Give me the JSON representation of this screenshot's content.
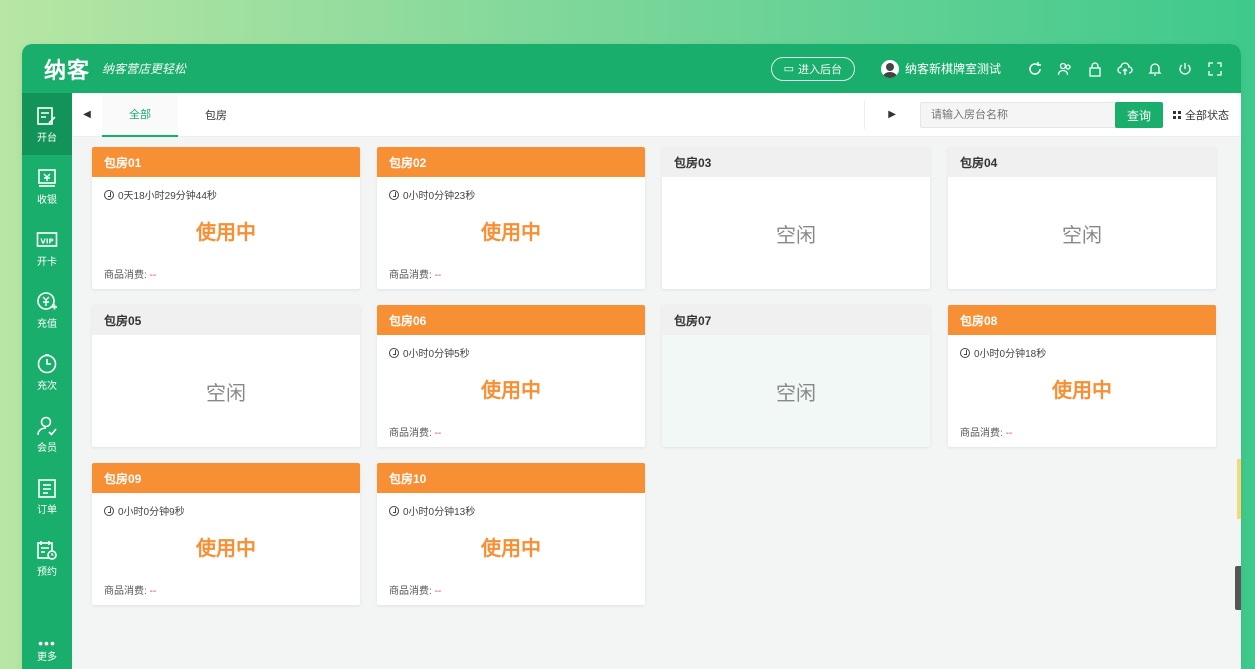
{
  "topbar": {
    "brand": "纳客",
    "slogan": "纳客营店更轻松",
    "backend_label": "进入后台",
    "user_name": "纳客新棋牌室测试"
  },
  "sidebar": {
    "items": [
      {
        "label": "开台",
        "icon": "open-table-icon"
      },
      {
        "label": "收银",
        "icon": "cashier-icon"
      },
      {
        "label": "开卡",
        "icon": "vip-card-icon"
      },
      {
        "label": "充值",
        "icon": "recharge-icon"
      },
      {
        "label": "充次",
        "icon": "recharge-times-icon"
      },
      {
        "label": "会员",
        "icon": "member-icon"
      },
      {
        "label": "订单",
        "icon": "order-icon"
      },
      {
        "label": "预约",
        "icon": "reservation-icon"
      }
    ],
    "more_label": "更多"
  },
  "tabs": [
    {
      "label": "全部",
      "active": true
    },
    {
      "label": "包房",
      "active": false
    }
  ],
  "search": {
    "placeholder": "请输入房台名称",
    "query_label": "查询",
    "all_status_label": "全部状态"
  },
  "rooms": [
    {
      "name": "包房01",
      "status": "使用中",
      "timer": "0天18小时29分钟44秒",
      "consume_label": "商品消费:",
      "consume_value": "--"
    },
    {
      "name": "包房02",
      "status": "使用中",
      "timer": "0小时0分钟23秒",
      "consume_label": "商品消费:",
      "consume_value": "--"
    },
    {
      "name": "包房03",
      "status": "空闲"
    },
    {
      "name": "包房04",
      "status": "空闲"
    },
    {
      "name": "包房05",
      "status": "空闲"
    },
    {
      "name": "包房06",
      "status": "使用中",
      "timer": "0小时0分钟5秒",
      "consume_label": "商品消费:",
      "consume_value": "--"
    },
    {
      "name": "包房07",
      "status": "空闲"
    },
    {
      "name": "包房08",
      "status": "使用中",
      "timer": "0小时0分钟18秒",
      "consume_label": "商品消费:",
      "consume_value": "--"
    },
    {
      "name": "包房09",
      "status": "使用中",
      "timer": "0小时0分钟9秒",
      "consume_label": "商品消费:",
      "consume_value": "--"
    },
    {
      "name": "包房10",
      "status": "使用中",
      "timer": "0小时0分钟13秒",
      "consume_label": "商品消费:",
      "consume_value": "--"
    }
  ],
  "colors": {
    "brand_green": "#1aae6c",
    "busy_orange": "#f78f35",
    "idle_gray": "#f0f0f0"
  }
}
